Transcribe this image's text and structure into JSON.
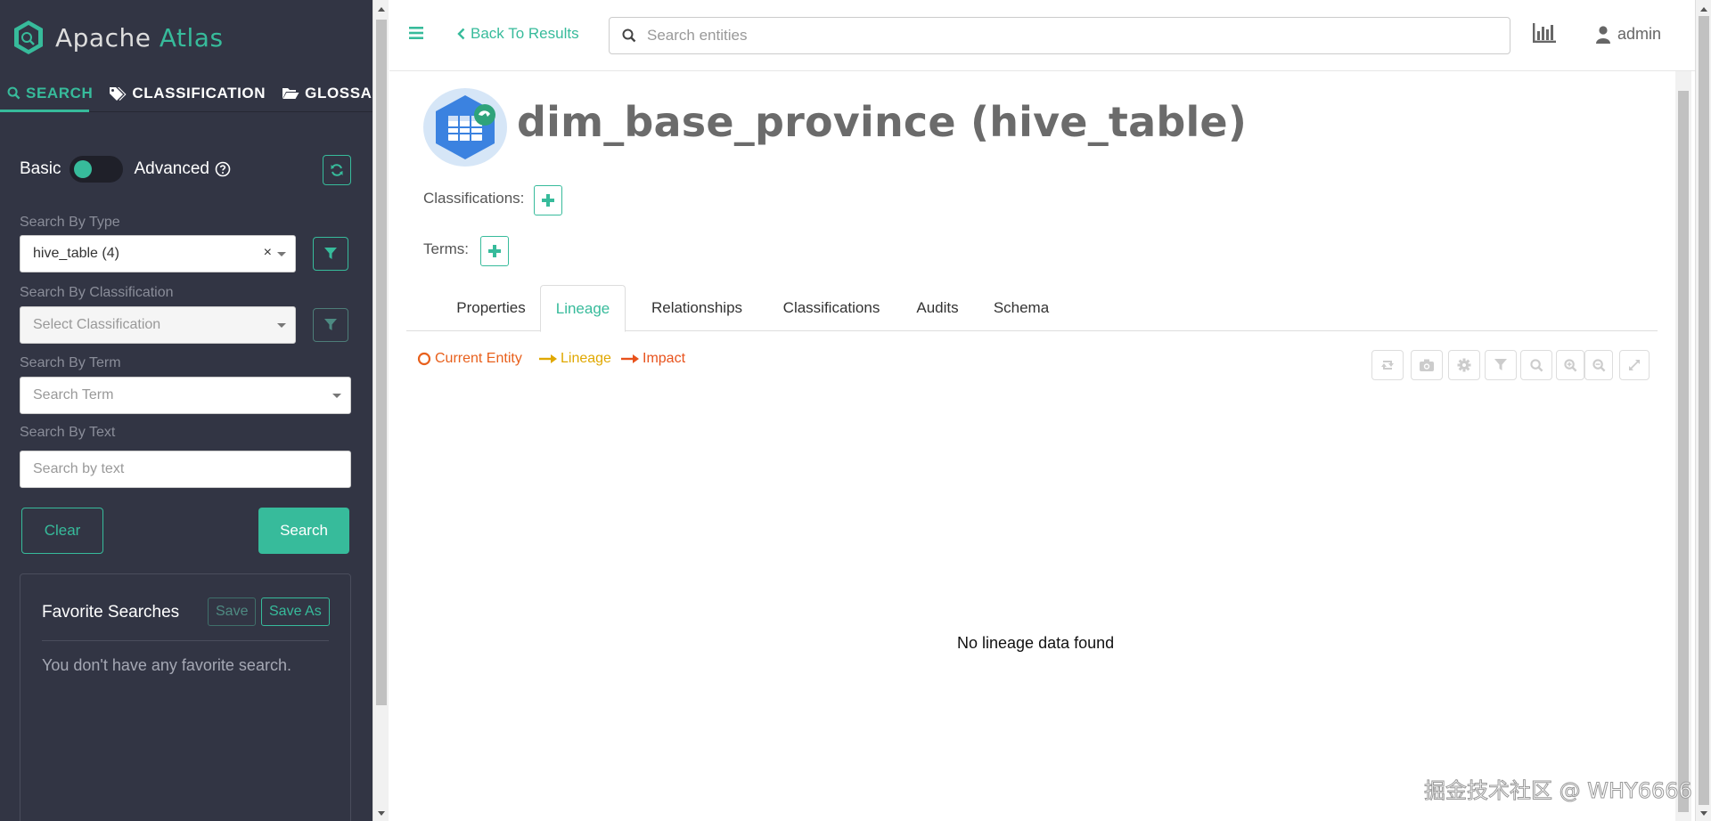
{
  "brand": {
    "name_prefix": "Apache",
    "name_accent": "Atlas"
  },
  "sidebar": {
    "tabs": [
      {
        "label": "SEARCH",
        "icon": "search-icon",
        "active": true
      },
      {
        "label": "CLASSIFICATION",
        "icon": "tag-icon",
        "active": false
      },
      {
        "label": "GLOSSARY",
        "icon": "folder-open-icon",
        "active": false
      }
    ],
    "toggle": {
      "left_label": "Basic",
      "right_label": "Advanced",
      "mode": "Basic"
    },
    "fields": {
      "type_label": "Search By Type",
      "type_value": "hive_table (4)",
      "classification_label": "Search By Classification",
      "classification_placeholder": "Select Classification",
      "term_label": "Search By Term",
      "term_placeholder": "Search Term",
      "text_label": "Search By Text",
      "text_placeholder": "Search by text"
    },
    "buttons": {
      "clear": "Clear",
      "search": "Search"
    },
    "favorites": {
      "title": "Favorite Searches",
      "save": "Save",
      "save_as": "Save As",
      "empty": "You don't have any favorite search."
    }
  },
  "topbar": {
    "back": "Back To Results",
    "search_placeholder": "Search entities",
    "user": "admin"
  },
  "entity": {
    "title": "dim_base_province (hive_table)",
    "classifications_label": "Classifications:",
    "terms_label": "Terms:"
  },
  "tabs": [
    {
      "label": "Properties",
      "active": false
    },
    {
      "label": "Lineage",
      "active": true
    },
    {
      "label": "Relationships",
      "active": false
    },
    {
      "label": "Classifications",
      "active": false
    },
    {
      "label": "Audits",
      "active": false
    },
    {
      "label": "Schema",
      "active": false
    }
  ],
  "lineage": {
    "legend": [
      {
        "label": "Current Entity",
        "color": "#e8601c"
      },
      {
        "label": "Lineage",
        "color": "#e0a800"
      },
      {
        "label": "Impact",
        "color": "#e8521c"
      }
    ],
    "tools": [
      "refresh-icon",
      "camera-icon",
      "gear-icon",
      "filter-icon",
      "search-icon",
      "zoom-in-icon",
      "zoom-out-icon",
      "fullscreen-icon"
    ],
    "empty": "No lineage data found"
  },
  "watermark": "掘金技术社区 @ WHY6666",
  "colors": {
    "accent": "#37bb9b",
    "sidebar_bg": "#323544"
  }
}
